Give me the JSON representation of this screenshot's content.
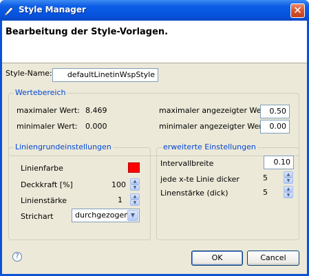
{
  "window": {
    "title": "Style Manager",
    "close_glyph": "✕",
    "banner_title": "Bearbeitung der Style-Vorlagen."
  },
  "style_name": {
    "label": "Style-Name:",
    "value": "defaultLinetinWspStyle"
  },
  "wertebereich": {
    "title": "Wertebereich",
    "max_label": "maximaler Wert:",
    "max_value": "8.469",
    "min_label": "minimaler Wert:",
    "min_value": "0.000",
    "max_shown_label": "maximaler angezeigter Wert:",
    "max_shown_value": "0.50",
    "min_shown_label": "minimaler angezeigter Wert:",
    "min_shown_value": "0.00"
  },
  "liniengrund": {
    "title": "Liniengrundeinstellungen",
    "color_label": "Linienfarbe",
    "color_value": "#ff0000",
    "opacity_label": "Deckkraft [%]",
    "opacity_value": "100",
    "width_label": "Linienstärke",
    "width_value": "1",
    "dash_label": "Strichart",
    "dash_value": "durchgezogen"
  },
  "erweitert": {
    "title": "erweiterte Einstellungen",
    "interval_label": "Intervallbreite",
    "interval_value": "0.10",
    "every_nth_label": "jede x-te Linie dicker",
    "every_nth_value": "5",
    "thick_width_label": "Linenstärke (dick)",
    "thick_width_value": "5"
  },
  "footer": {
    "help_glyph": "?",
    "ok_label": "OK",
    "cancel_label": "Cancel"
  },
  "icons": {
    "app": "style-manager-icon",
    "help": "help-icon",
    "close": "close-icon"
  }
}
